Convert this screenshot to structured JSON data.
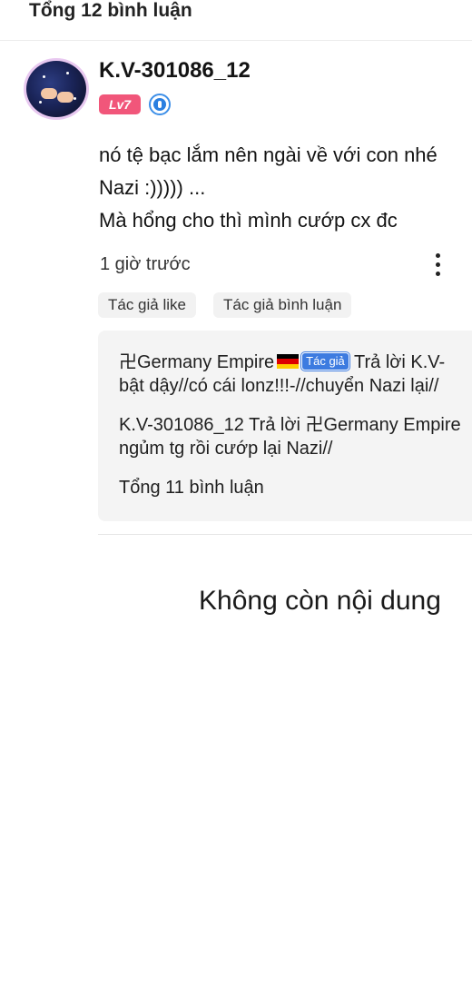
{
  "header": {
    "title": "Tổng 12 bình luận"
  },
  "comment": {
    "username": "K.V-301086_12",
    "level_badge": "Lv7",
    "text_lines": [
      "nó tệ bạc lắm nên ngài về với con nhé",
      "Nazi :))))) ...",
      "Mà hổng cho thì mình cướp cx đc"
    ],
    "time": "1 giờ trước",
    "chips": [
      "Tác giả like",
      "Tác giả bình luận"
    ],
    "replies": [
      {
        "author": "卍Germany Empire",
        "author_tag": "Tác giả",
        "action": "Trả lời K.V-",
        "line2": "bật dậy//có cái lonz!!!-//chuyển Nazi lại//"
      },
      {
        "line1": "K.V-301086_12 Trả lời 卍Germany Empire",
        "line2": "ngủm tg rồi cướp lại Nazi//"
      }
    ],
    "total_replies": "Tổng 11 bình luận"
  },
  "footer": {
    "no_more": "Không còn nội dung"
  },
  "icons": {
    "avatar": "avatar-image",
    "rank": "rank-badge-icon",
    "more": "more-vertical-icon",
    "flag": "germany-flag-icon"
  },
  "colors": {
    "level_badge": "#f1567a",
    "author_tag": "#3d7be0",
    "reply_box_bg": "#f4f4f4"
  }
}
